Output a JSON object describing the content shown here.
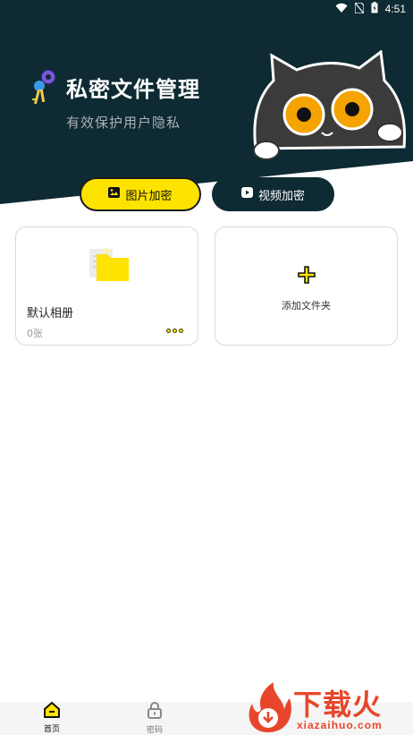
{
  "status_bar": {
    "time": "4:51"
  },
  "header": {
    "title": "私密文件管理",
    "subtitle": "有效保护用户隐私"
  },
  "actions": {
    "photo_label": "图片加密",
    "video_label": "视频加密"
  },
  "albums": [
    {
      "name": "默认相册",
      "count": "0张"
    }
  ],
  "add_folder": {
    "label": "添加文件夹"
  },
  "bottom_nav": {
    "items": [
      {
        "label": "首页",
        "active": true
      },
      {
        "label": "密码",
        "active": false
      }
    ]
  },
  "watermark": {
    "text": "下载火",
    "url": "xiazaihuo.com"
  },
  "colors": {
    "accent": "#fde300",
    "dark": "#0e2a33",
    "watermark": "#e8462a"
  }
}
